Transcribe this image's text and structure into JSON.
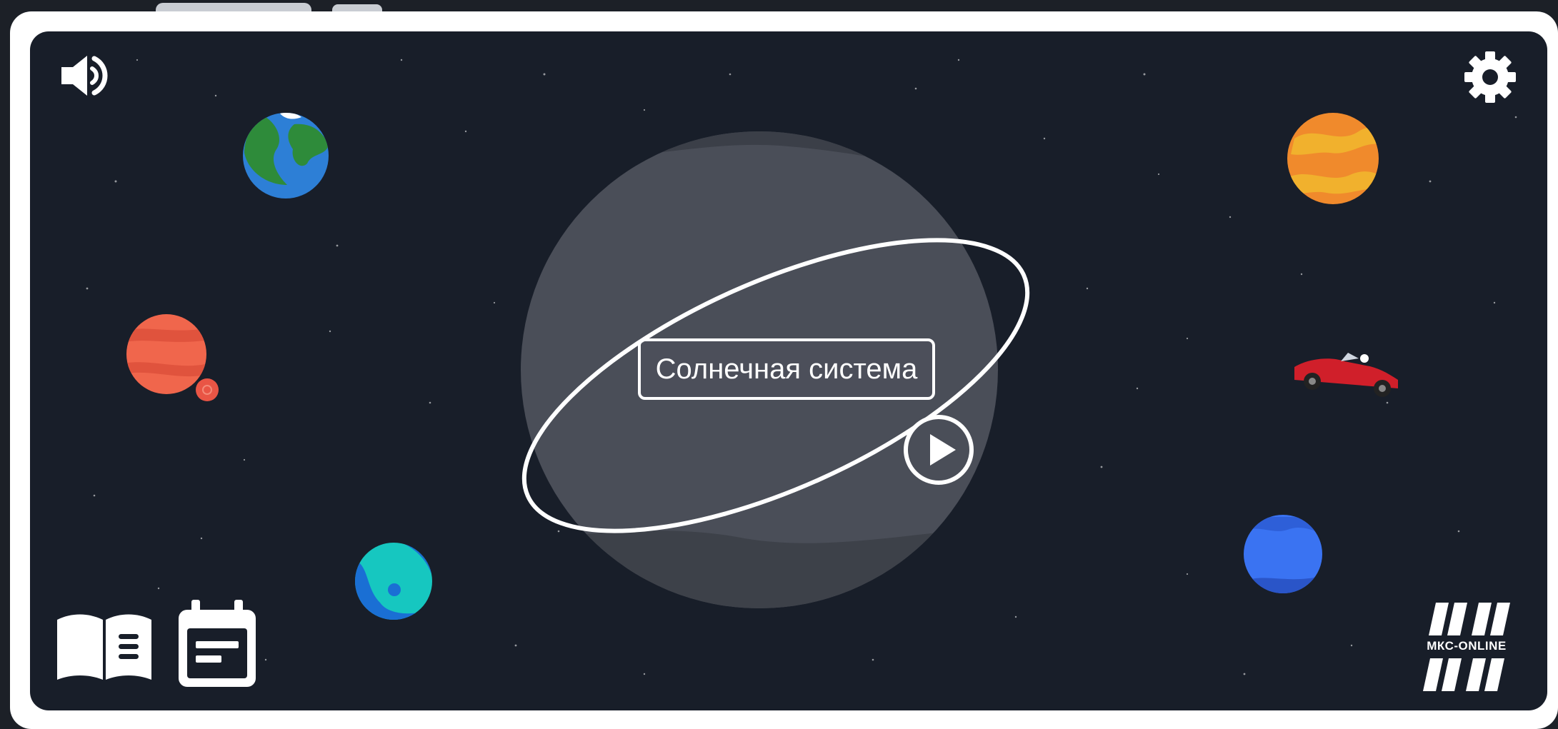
{
  "main": {
    "title_button": "Солнечная система"
  },
  "icons": {
    "sound": "speaker-icon",
    "settings": "gear-icon",
    "book": "book-icon",
    "calendar": "calendar-icon",
    "play": "play-icon"
  },
  "brand": {
    "logo_text": "МКС-ONLINE"
  },
  "colors": {
    "background": "#181e29",
    "frame": "#ffffff",
    "accent": "#ffffff",
    "central_planet": "#4b4f59"
  }
}
